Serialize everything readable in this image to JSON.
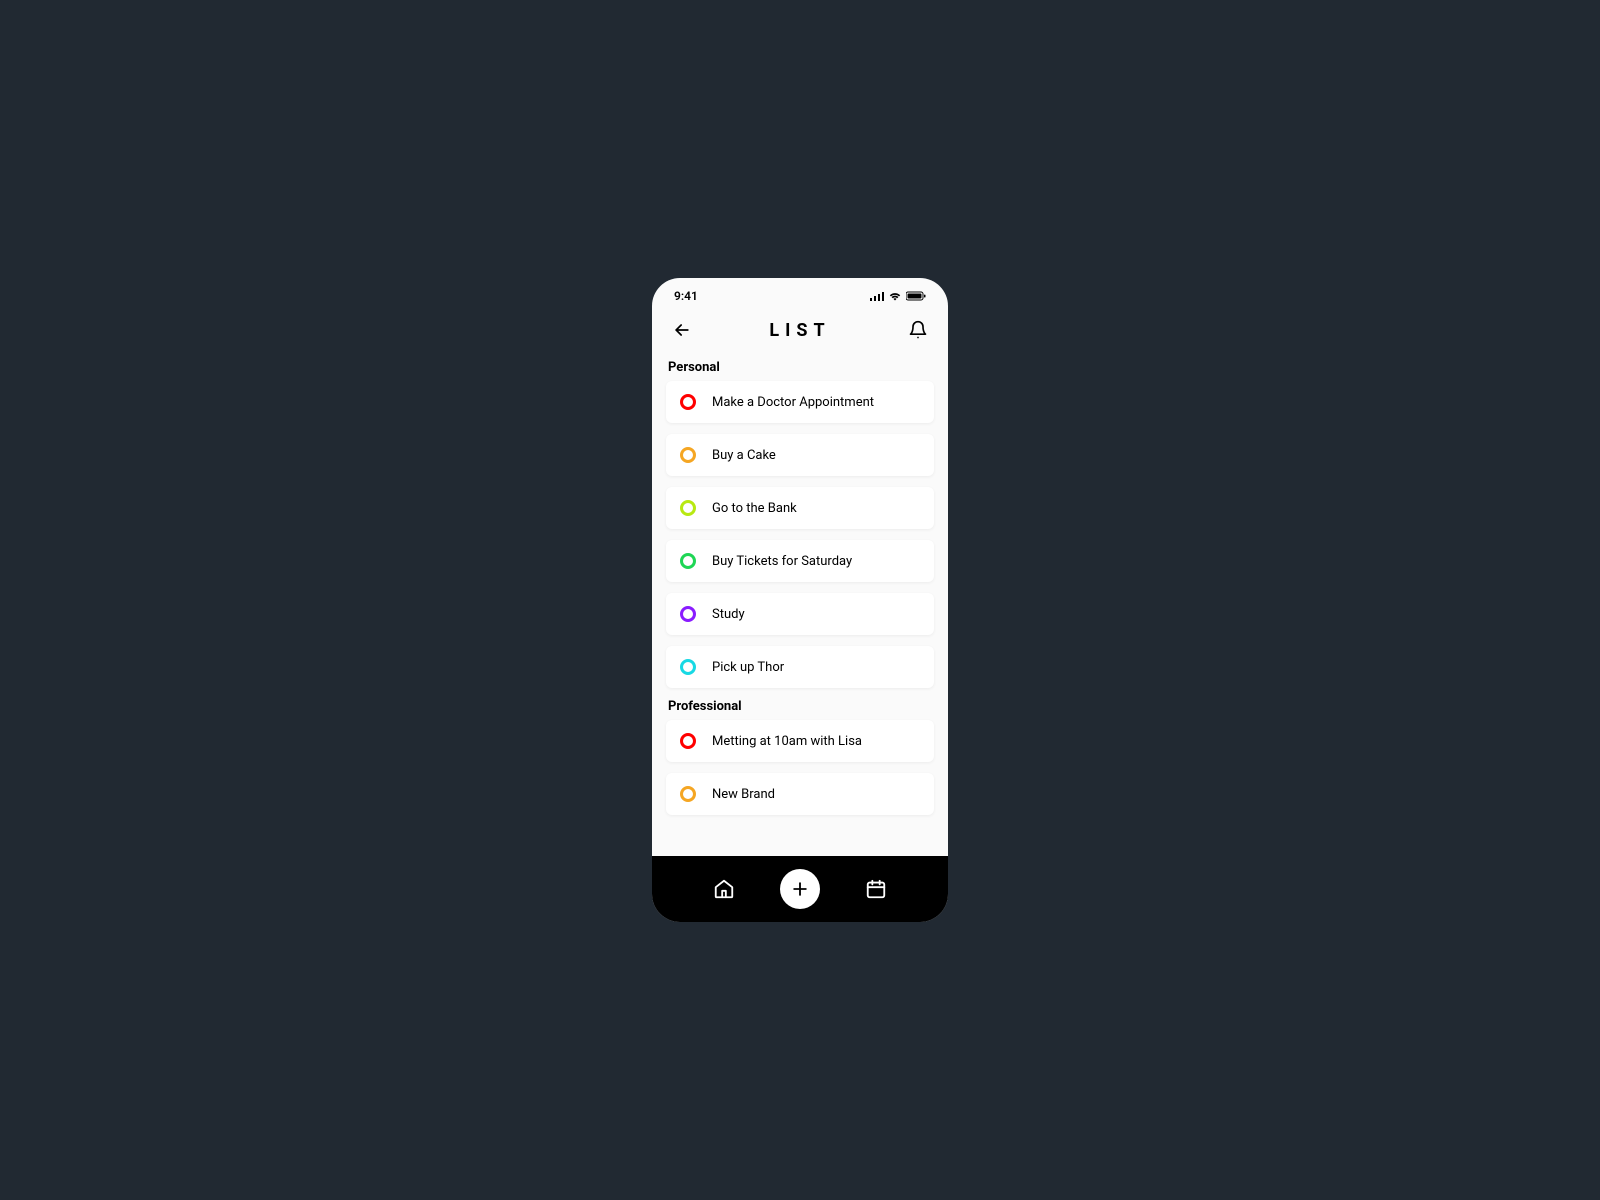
{
  "status": {
    "time": "9:41"
  },
  "header": {
    "title": "LIST"
  },
  "sections": [
    {
      "title": "Personal",
      "items": [
        {
          "label": "Make a Doctor Appointment",
          "color": "#ff0000"
        },
        {
          "label": "Buy a Cake",
          "color": "#f5a623"
        },
        {
          "label": "Go to the Bank",
          "color": "#b8e912"
        },
        {
          "label": "Buy Tickets for Saturday",
          "color": "#1fd655"
        },
        {
          "label": "Study",
          "color": "#8a1cff"
        },
        {
          "label": "Pick up Thor",
          "color": "#18d9e4"
        }
      ]
    },
    {
      "title": "Professional",
      "items": [
        {
          "label": "Metting at 10am with Lisa",
          "color": "#ff0000"
        },
        {
          "label": "New Brand",
          "color": "#f5a623"
        }
      ]
    }
  ]
}
